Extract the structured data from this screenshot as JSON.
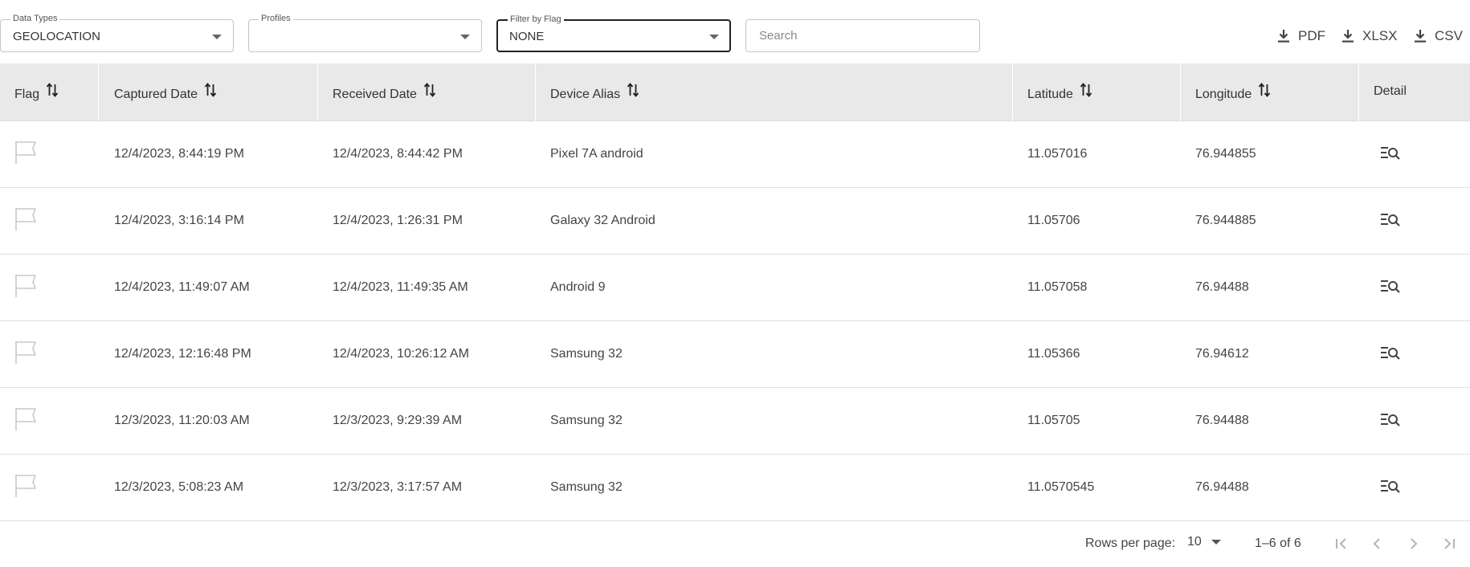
{
  "filters": {
    "data_types": {
      "label": "Data Types",
      "value": "GEOLOCATION"
    },
    "profiles": {
      "label": "Profiles",
      "value": ""
    },
    "flag": {
      "label": "Filter by Flag",
      "value": "NONE"
    },
    "search": {
      "placeholder": "Search",
      "value": ""
    }
  },
  "exports": {
    "pdf": "PDF",
    "xlsx": "XLSX",
    "csv": "CSV",
    "icon": "download-icon"
  },
  "table": {
    "columns": {
      "flag": "Flag",
      "captured": "Captured Date",
      "received": "Received Date",
      "device": "Device Alias",
      "latitude": "Latitude",
      "longitude": "Longitude",
      "detail": "Detail"
    },
    "rows": [
      {
        "captured": "12/4/2023, 8:44:19 PM",
        "received": "12/4/2023, 8:44:42 PM",
        "device": "Pixel 7A android",
        "latitude": "11.057016",
        "longitude": "76.944855"
      },
      {
        "captured": "12/4/2023, 3:16:14 PM",
        "received": "12/4/2023, 1:26:31 PM",
        "device": "Galaxy 32 Android",
        "latitude": "11.05706",
        "longitude": "76.944885"
      },
      {
        "captured": "12/4/2023, 11:49:07 AM",
        "received": "12/4/2023, 11:49:35 AM",
        "device": "Android 9",
        "latitude": "11.057058",
        "longitude": "76.94488"
      },
      {
        "captured": "12/4/2023, 12:16:48 PM",
        "received": "12/4/2023, 10:26:12 AM",
        "device": "Samsung 32",
        "latitude": "11.05366",
        "longitude": "76.94612"
      },
      {
        "captured": "12/3/2023, 11:20:03 AM",
        "received": "12/3/2023, 9:29:39 AM",
        "device": "Samsung 32",
        "latitude": "11.05705",
        "longitude": "76.94488"
      },
      {
        "captured": "12/3/2023, 5:08:23 AM",
        "received": "12/3/2023, 3:17:57 AM",
        "device": "Samsung 32",
        "latitude": "11.0570545",
        "longitude": "76.94488"
      }
    ]
  },
  "pagination": {
    "rows_per_page_label": "Rows per page:",
    "rows_per_page": "10",
    "range": "1–6 of 6"
  }
}
